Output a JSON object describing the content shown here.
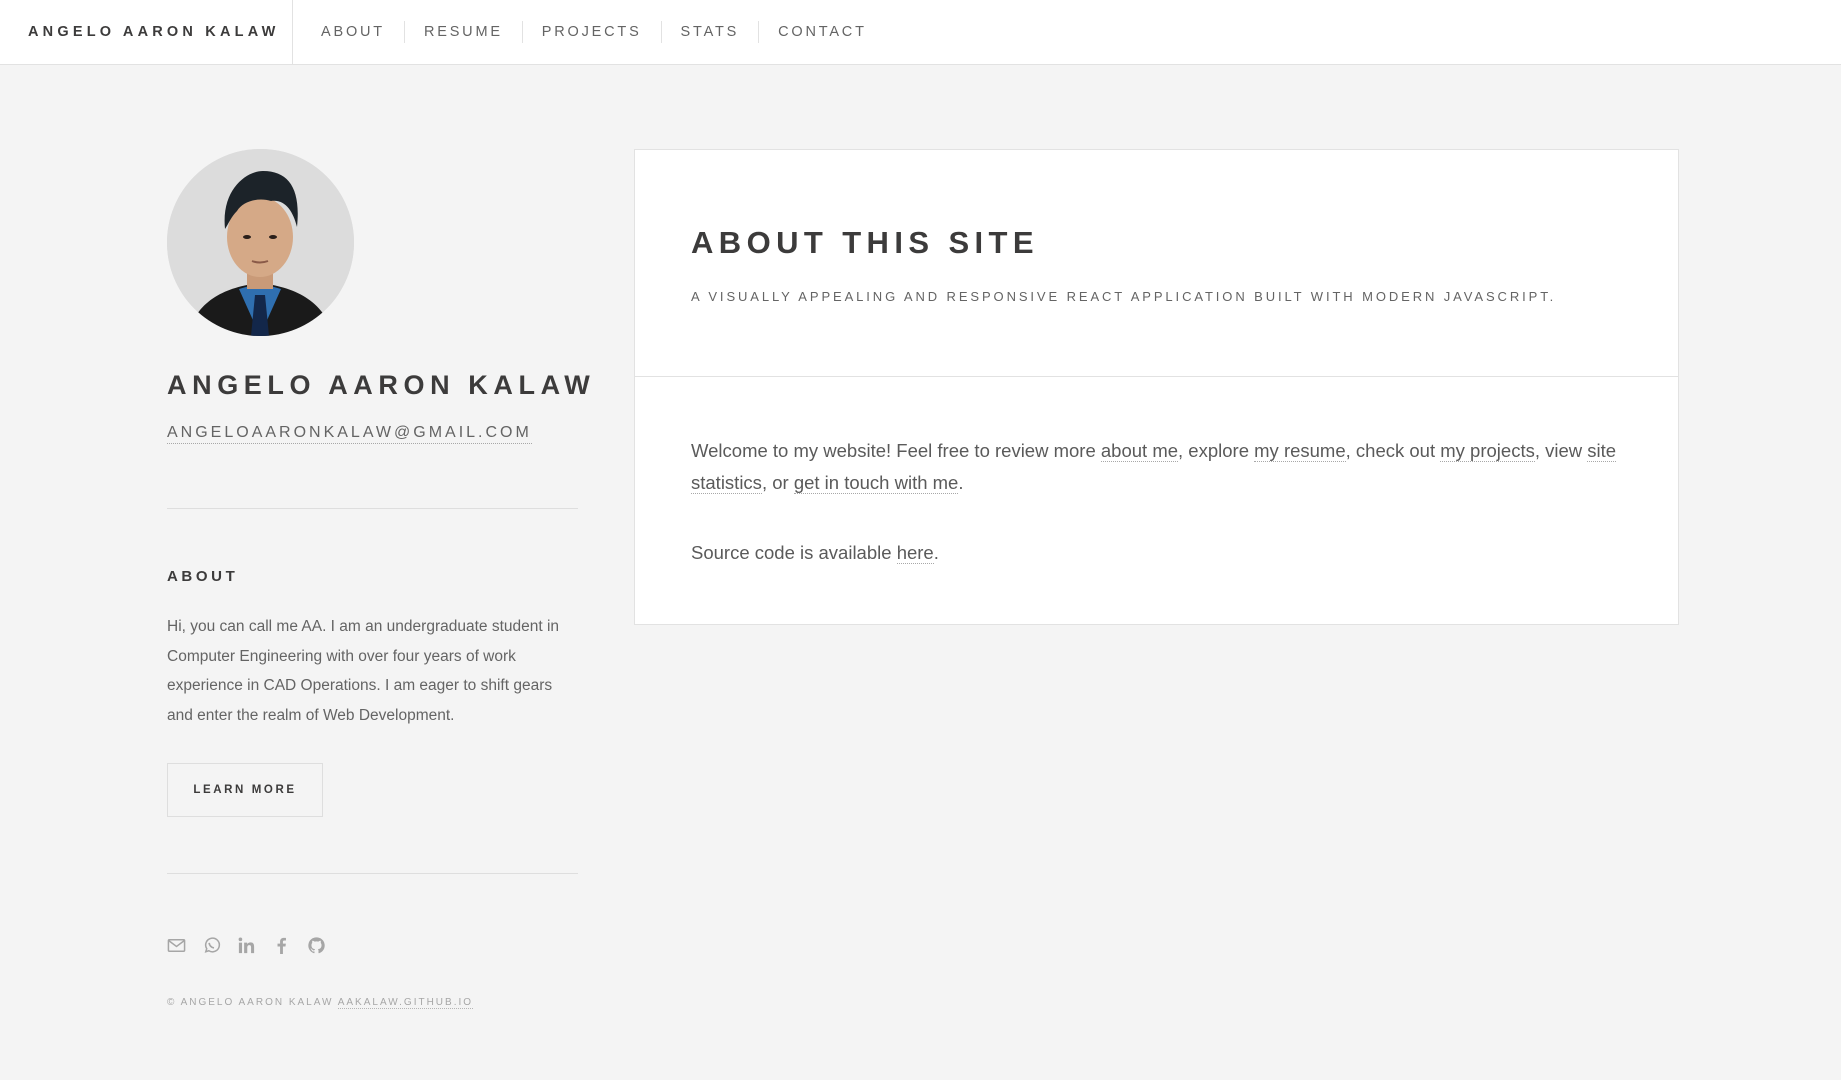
{
  "header": {
    "brand": "ANGELO AARON KALAW",
    "nav": [
      {
        "label": "ABOUT"
      },
      {
        "label": "RESUME"
      },
      {
        "label": "PROJECTS"
      },
      {
        "label": "STATS"
      },
      {
        "label": "CONTACT"
      }
    ]
  },
  "sidebar": {
    "name": "ANGELO AARON KALAW",
    "email": "ANGELOAARONKALAW@GMAIL.COM",
    "about_title": "ABOUT",
    "about_text": "Hi, you can call me AA. I am an undergraduate student in Computer Engineering with over four years of work experience in CAD Operations. I am eager to shift gears and enter the realm of Web Development.",
    "learn_more": "LEARN MORE",
    "socials": [
      "mail-icon",
      "whatsapp-icon",
      "linkedin-icon",
      "facebook-icon",
      "github-icon"
    ],
    "copyright_prefix": "© ANGELO AARON KALAW",
    "copyright_link": "AAKALAW.GITHUB.IO"
  },
  "main": {
    "title": "ABOUT THIS SITE",
    "subtitle": "A VISUALLY APPEALING AND RESPONSIVE REACT APPLICATION BUILT WITH MODERN JAVASCRIPT.",
    "p1": {
      "t1": "Welcome to my website! Feel free to review more ",
      "l1": "about me",
      "t2": ", explore ",
      "l2": "my resume",
      "t3": ", check out ",
      "l3": "my projects",
      "t4": ", view ",
      "l4": "site statistics",
      "t5": ", or ",
      "l5": "get in touch with me",
      "t6": "."
    },
    "p2": {
      "t1": "Source code is available ",
      "l1": "here",
      "t2": "."
    }
  },
  "colors": {
    "background": "#f4f4f4",
    "card": "#ffffff",
    "heading": "#3c3b3b",
    "text": "#646464",
    "border": "#e2e2e2",
    "icon": "#a6a6a6"
  }
}
